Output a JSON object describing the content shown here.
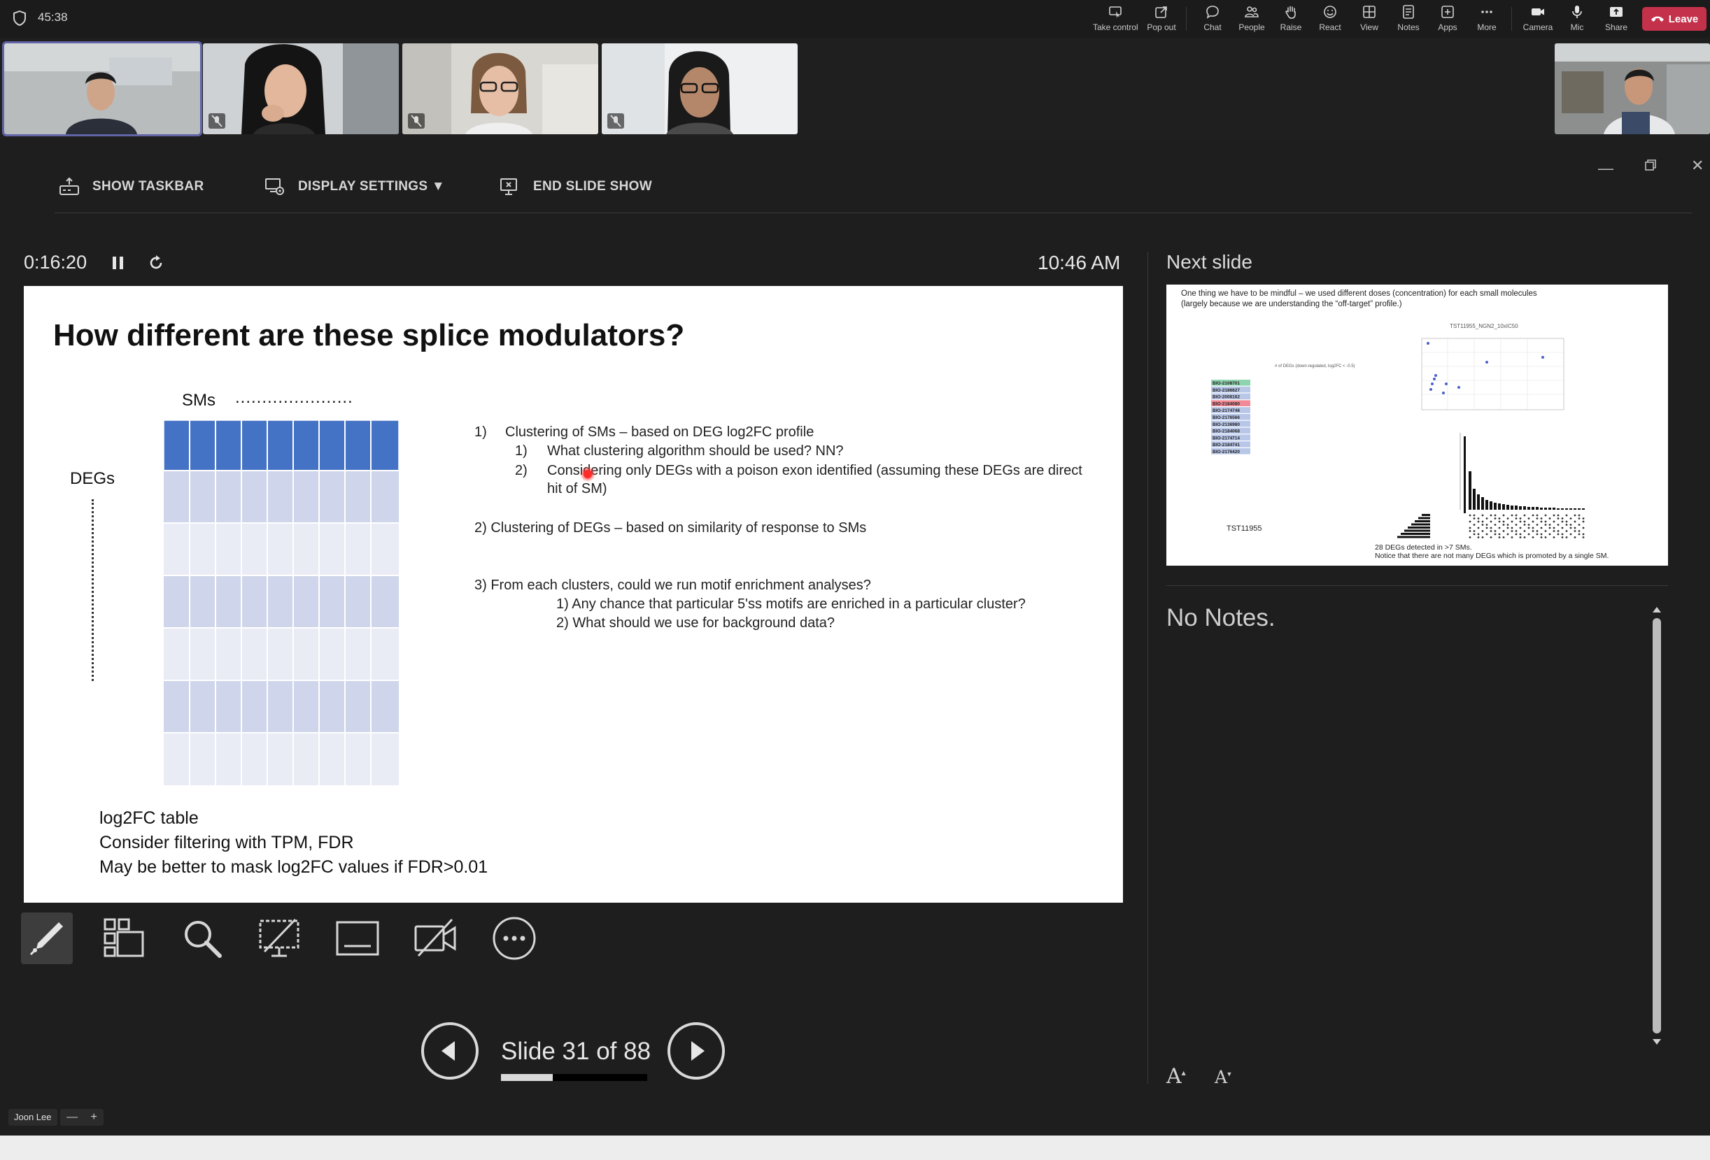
{
  "topbar": {
    "meeting_timer": "45:38",
    "buttons": {
      "take_control": "Take control",
      "pop_out": "Pop out",
      "chat": "Chat",
      "people": "People",
      "raise": "Raise",
      "react": "React",
      "view": "View",
      "notes": "Notes",
      "apps": "Apps",
      "more": "More",
      "camera": "Camera",
      "mic": "Mic",
      "share": "Share"
    },
    "leave_label": "Leave",
    "leave_color": "#c4314b"
  },
  "presenter": {
    "toolbar": {
      "show_taskbar": "SHOW TASKBAR",
      "display_settings": "DISPLAY SETTINGS ▼",
      "end_slide_show": "END SLIDE SHOW"
    },
    "elapsed_time": "0:16:20",
    "clock": "10:46 AM",
    "slide_counter": "Slide 31 of 88",
    "progress_fraction": 0.352,
    "next_slide_heading": "Next slide",
    "notes_text": "No Notes.",
    "font_larger": "A",
    "font_smaller": "A"
  },
  "slide": {
    "title": "How different are these splice modulators?",
    "sms_label": "SMs",
    "sms_dots": "......................",
    "degs_label": "DEGs",
    "header_color": "#4472c4",
    "bullets": {
      "b1": "1)",
      "b1_text": "Clustering of SMs – based on DEG log2FC profile",
      "b1_1": "1)",
      "b1_1_text": "What clustering algorithm should be used? NN?",
      "b1_2": "2)",
      "b1_2_text_a": "Considering only DEGs with a poison exon identified (assuming these DEGs are direct",
      "b1_2_text_b": "hit of SM)",
      "b2": "2) Clustering of DEGs – based on similarity of response to SMs",
      "b3": "3) From each clusters, could we run motif enrichment analyses?",
      "b3_1": "1) Any chance that particular 5'ss motifs are enriched in a particular cluster?",
      "b3_2": "2) What should we use for background data?"
    },
    "table_notes": [
      "log2FC table",
      "Consider filtering with TPM, FDR",
      "May be better to mask log2FC values if FDR>0.01"
    ]
  },
  "next_slide": {
    "caption_line1": "One thing we have to be mindful – we used different doses (concentration) for each small molecules",
    "caption_line2": "(largely because we are understanding the “off-target” profile.)",
    "plot_title": "TST11955_NGN2_10xIC50",
    "table_header": "# of DEGs (down-regulated, log2FC < -0.5)",
    "ids": [
      "BIO-2108701",
      "BIO-2186627",
      "BIO-2006162",
      "BIO-2184080",
      "BIO-2174748",
      "BIO-2176566",
      "BIO-2136980",
      "BIO-2184068",
      "BIO-2174714",
      "BIO-2184741",
      "BIO-2176420"
    ],
    "tst_label": "TST11955",
    "caption_bottom1": "28 DEGs detected in >7 SMs.",
    "caption_bottom2": "Notice that there are not many DEGs which is promoted by a single SM."
  },
  "participant_name": "Joon Lee",
  "zoom_minus": "—",
  "zoom_plus": "+"
}
